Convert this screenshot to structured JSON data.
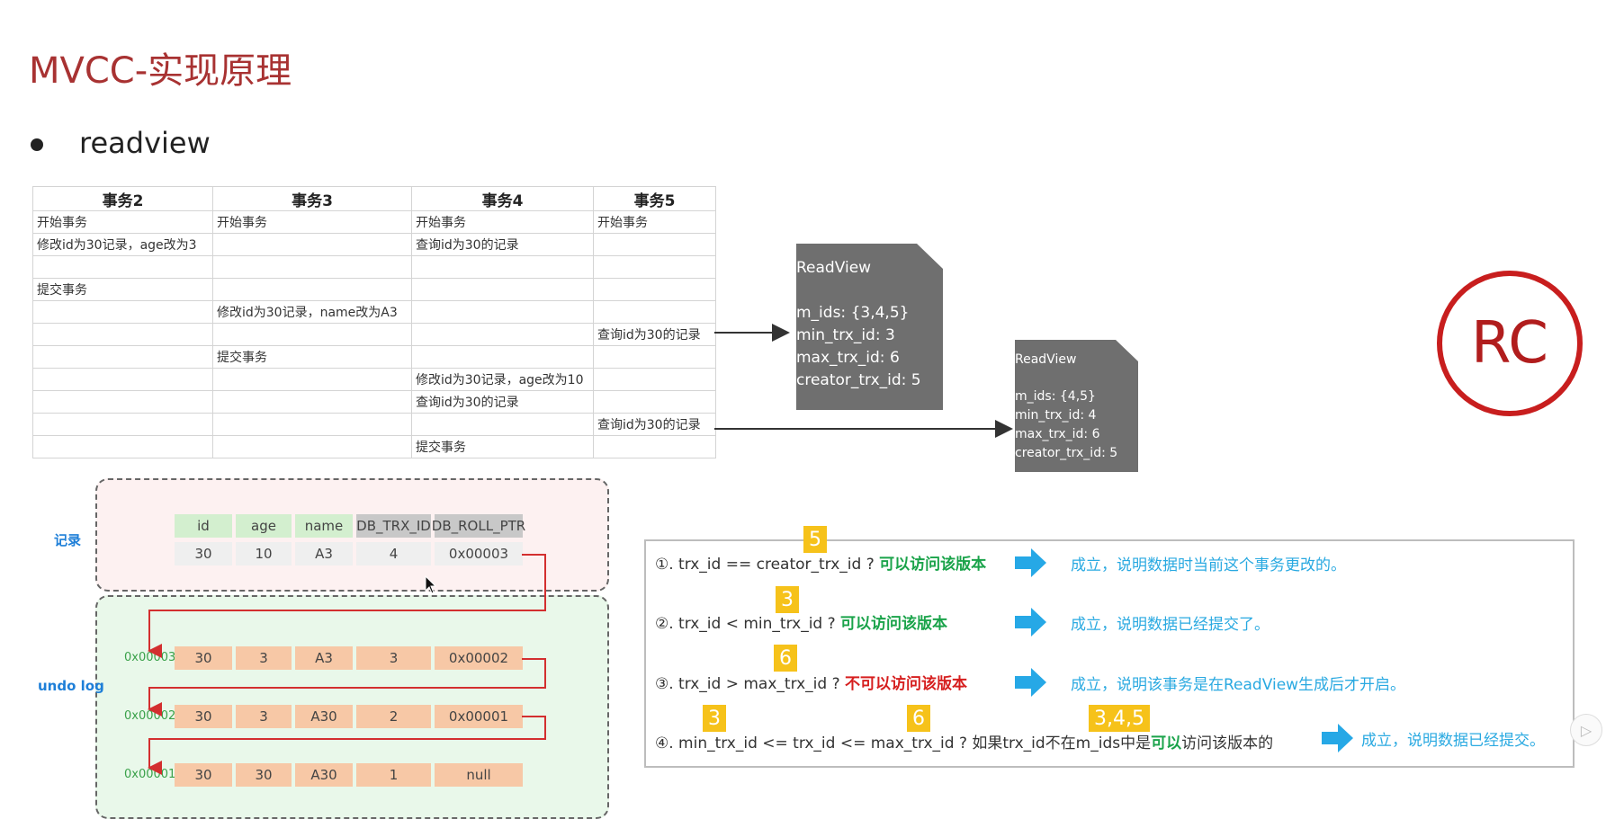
{
  "slide": {
    "title": "MVCC-实现原理",
    "bullet": "readview"
  },
  "tx_table": {
    "headers": [
      "事务2",
      "事务3",
      "事务4",
      "事务5"
    ],
    "rows": [
      [
        "开始事务",
        "开始事务",
        "开始事务",
        "开始事务"
      ],
      [
        "修改id为30记录，age改为3",
        "",
        "查询id为30的记录",
        ""
      ],
      [
        "",
        "",
        "",
        ""
      ],
      [
        "提交事务",
        "",
        "",
        ""
      ],
      [
        "",
        "修改id为30记录，name改为A3",
        "",
        ""
      ],
      [
        "",
        "",
        "",
        "查询id为30的记录"
      ],
      [
        "",
        "提交事务",
        "",
        ""
      ],
      [
        "",
        "",
        "修改id为30记录，age改为10",
        ""
      ],
      [
        "",
        "",
        "查询id为30的记录",
        ""
      ],
      [
        "",
        "",
        "",
        "查询id为30的记录"
      ],
      [
        "",
        "",
        "提交事务",
        ""
      ]
    ]
  },
  "readview1": {
    "title": "ReadView",
    "m_ids": "m_ids: {3,4,5}",
    "min": "min_trx_id: 3",
    "max": "max_trx_id: 6",
    "creator": "creator_trx_id: 5"
  },
  "readview2": {
    "title": "ReadView",
    "m_ids": "m_ids: {4,5}",
    "min": "min_trx_id: 4",
    "max": "max_trx_id: 6",
    "creator": "creator_trx_id: 5"
  },
  "rc_label": "RC",
  "record": {
    "label": "记录",
    "headers": [
      "id",
      "age",
      "name",
      "DB_TRX_ID",
      "DB_ROLL_PTR"
    ],
    "values": [
      "30",
      "10",
      "A3",
      "4",
      "0x00003"
    ]
  },
  "undo": {
    "label": "undo log",
    "rows": [
      {
        "addr": "0x00003",
        "values": [
          "30",
          "3",
          "A3",
          "3",
          "0x00002"
        ]
      },
      {
        "addr": "0x00002",
        "values": [
          "30",
          "3",
          "A30",
          "2",
          "0x00001"
        ]
      },
      {
        "addr": "0x00001",
        "values": [
          "30",
          "30",
          "A30",
          "1",
          "null"
        ]
      }
    ]
  },
  "conditions": [
    {
      "prefix": "①. trx_id  == creator_trx_id ? ",
      "verdict": "可以访问该版本",
      "verdict_type": "ok",
      "result": "成立，说明数据时当前这个事务更改的。",
      "badges": [
        "5"
      ]
    },
    {
      "prefix": "②. trx_id < min_trx_id ? ",
      "verdict": "可以访问该版本",
      "verdict_type": "ok",
      "result": "成立，说明数据已经提交了。",
      "badges": [
        "3"
      ]
    },
    {
      "prefix": "③. trx_id > max_trx_id ? ",
      "verdict": "不可以访问该版本",
      "verdict_type": "no",
      "result": "成立，说明该事务是在ReadView生成后才开启。",
      "badges": [
        "6"
      ]
    },
    {
      "prefix": "④. min_trx_id <= trx_id <= max_trx_id ? 如果trx_id不在m_ids中是",
      "verdict": "可以",
      "suffix": "访问该版本的",
      "verdict_type": "ok",
      "result": "成立，说明数据已经提交。",
      "badges": [
        "3",
        "6",
        "3,4,5"
      ]
    }
  ],
  "colors": {
    "title": "#a83232",
    "ok": "#1aa34a",
    "no": "#d61f1f",
    "result": "#29a9e1",
    "badge": "#f6c21a",
    "rc": "#c81e1e"
  }
}
